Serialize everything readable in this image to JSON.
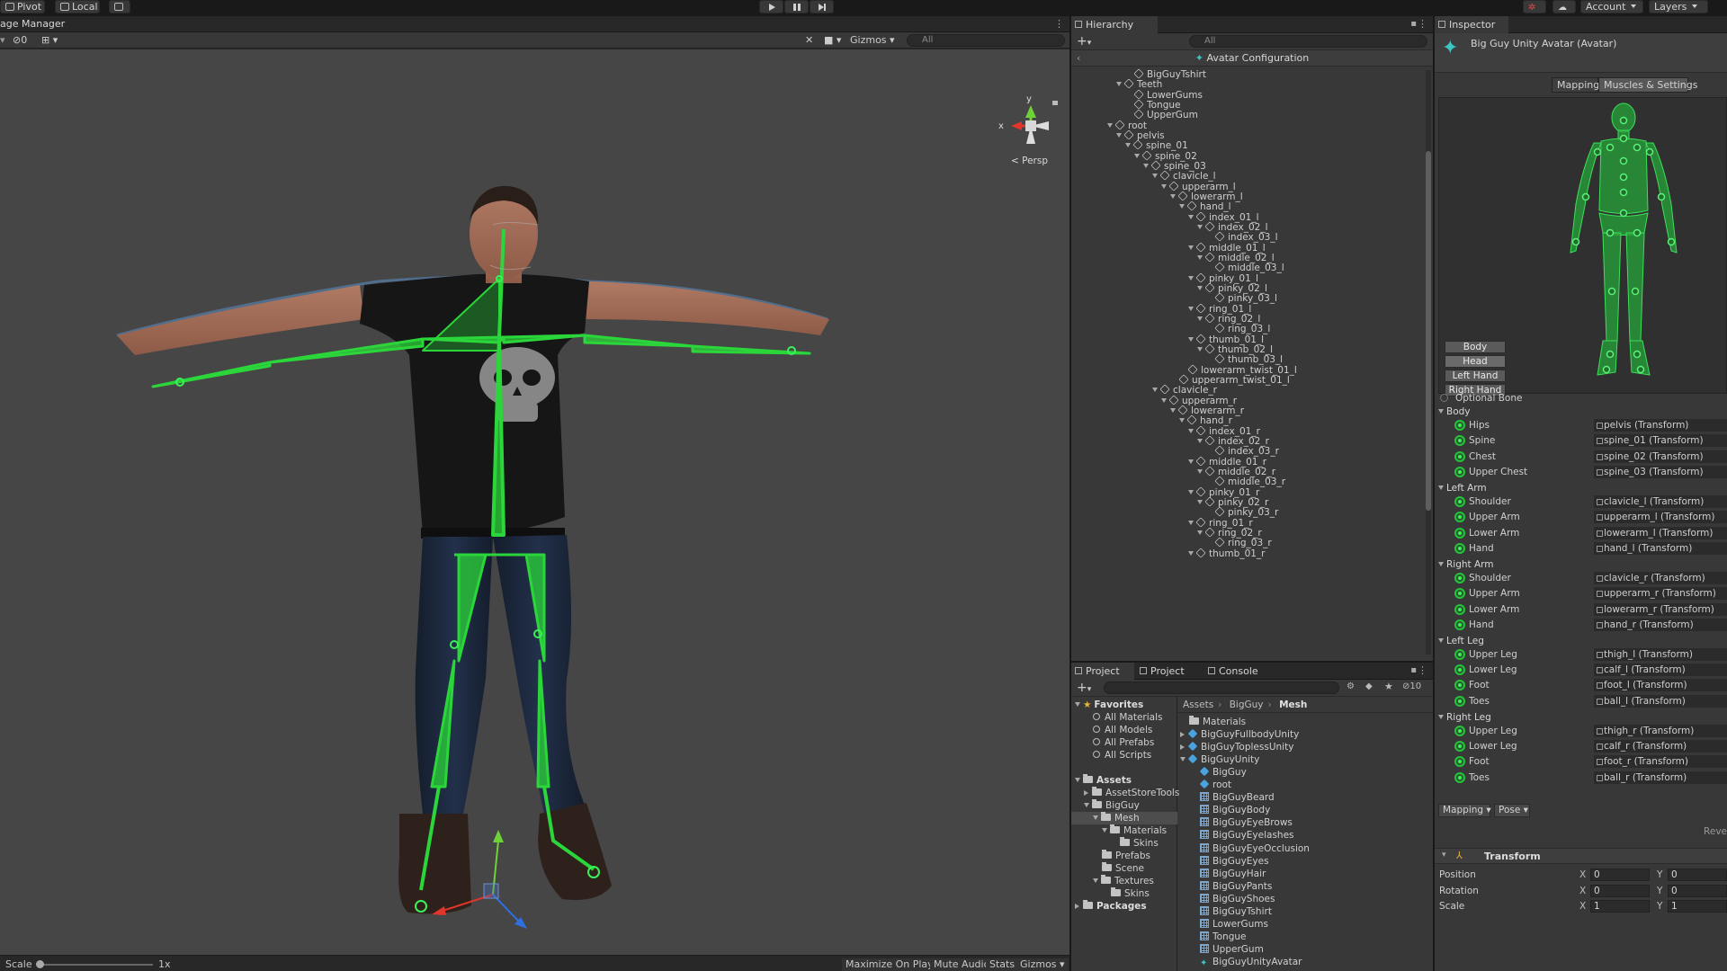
{
  "toolbar": {
    "pivot_label": "Pivot",
    "local_label": "Local",
    "account_label": "Account",
    "layers_label": "Layers"
  },
  "scene": {
    "tab_label": "age Manager",
    "hidden_count": "0",
    "gizmos_label": "Gizmos",
    "search_placeholder": "All",
    "persp_label": "< Persp",
    "axis_x": "x",
    "axis_y": "y",
    "bottom": {
      "scale_label": "Scale",
      "scale_value": "1x",
      "maximize_label": "Maximize On Play",
      "mute_label": "Mute Audio",
      "stats_label": "Stats",
      "gizmos_label": "Gizmos"
    }
  },
  "hierarchy": {
    "tab_label": "Hierarchy",
    "search_placeholder": "All",
    "breadcrumb": "Avatar Configuration",
    "rows": [
      {
        "label": "BigGuyTshirt",
        "depth": 3,
        "fold": false
      },
      {
        "label": "Teeth",
        "depth": 2,
        "fold": true
      },
      {
        "label": "LowerGums",
        "depth": 3,
        "fold": false
      },
      {
        "label": "Tongue",
        "depth": 3,
        "fold": false
      },
      {
        "label": "UpperGum",
        "depth": 3,
        "fold": false
      },
      {
        "label": "root",
        "depth": 1,
        "fold": true
      },
      {
        "label": "pelvis",
        "depth": 2,
        "fold": true
      },
      {
        "label": "spine_01",
        "depth": 3,
        "fold": true
      },
      {
        "label": "spine_02",
        "depth": 4,
        "fold": true
      },
      {
        "label": "spine_03",
        "depth": 5,
        "fold": true
      },
      {
        "label": "clavicle_l",
        "depth": 6,
        "fold": true
      },
      {
        "label": "upperarm_l",
        "depth": 7,
        "fold": true
      },
      {
        "label": "lowerarm_l",
        "depth": 8,
        "fold": true
      },
      {
        "label": "hand_l",
        "depth": 9,
        "fold": true
      },
      {
        "label": "index_01_l",
        "depth": 10,
        "fold": true
      },
      {
        "label": "index_02_l",
        "depth": 11,
        "fold": true
      },
      {
        "label": "index_03_l",
        "depth": 12,
        "fold": false
      },
      {
        "label": "middle_01_l",
        "depth": 10,
        "fold": true
      },
      {
        "label": "middle_02_l",
        "depth": 11,
        "fold": true
      },
      {
        "label": "middle_03_l",
        "depth": 12,
        "fold": false
      },
      {
        "label": "pinky_01_l",
        "depth": 10,
        "fold": true
      },
      {
        "label": "pinky_02_l",
        "depth": 11,
        "fold": true
      },
      {
        "label": "pinky_03_l",
        "depth": 12,
        "fold": false
      },
      {
        "label": "ring_01_l",
        "depth": 10,
        "fold": true
      },
      {
        "label": "ring_02_l",
        "depth": 11,
        "fold": true
      },
      {
        "label": "ring_03_l",
        "depth": 12,
        "fold": false
      },
      {
        "label": "thumb_01_l",
        "depth": 10,
        "fold": true
      },
      {
        "label": "thumb_02_l",
        "depth": 11,
        "fold": true
      },
      {
        "label": "thumb_03_l",
        "depth": 12,
        "fold": false
      },
      {
        "label": "lowerarm_twist_01_l",
        "depth": 9,
        "fold": false
      },
      {
        "label": "upperarm_twist_01_l",
        "depth": 8,
        "fold": false
      },
      {
        "label": "clavicle_r",
        "depth": 6,
        "fold": true
      },
      {
        "label": "upperarm_r",
        "depth": 7,
        "fold": true
      },
      {
        "label": "lowerarm_r",
        "depth": 8,
        "fold": true
      },
      {
        "label": "hand_r",
        "depth": 9,
        "fold": true
      },
      {
        "label": "index_01_r",
        "depth": 10,
        "fold": true
      },
      {
        "label": "index_02_r",
        "depth": 11,
        "fold": true
      },
      {
        "label": "index_03_r",
        "depth": 12,
        "fold": false
      },
      {
        "label": "middle_01_r",
        "depth": 10,
        "fold": true
      },
      {
        "label": "middle_02_r",
        "depth": 11,
        "fold": true
      },
      {
        "label": "middle_03_r",
        "depth": 12,
        "fold": false
      },
      {
        "label": "pinky_01_r",
        "depth": 10,
        "fold": true
      },
      {
        "label": "pinky_02_r",
        "depth": 11,
        "fold": true
      },
      {
        "label": "pinky_03_r",
        "depth": 12,
        "fold": false
      },
      {
        "label": "ring_01_r",
        "depth": 10,
        "fold": true
      },
      {
        "label": "ring_02_r",
        "depth": 11,
        "fold": true
      },
      {
        "label": "ring_03_r",
        "depth": 12,
        "fold": false
      },
      {
        "label": "thumb_01_r",
        "depth": 10,
        "fold": true
      }
    ]
  },
  "project": {
    "tabs": [
      "Project",
      "Project",
      "Console"
    ],
    "hidden_count": "10",
    "breadcrumb": [
      "Assets",
      "BigGuy",
      "Mesh"
    ],
    "left_tree": [
      {
        "label": "Favorites",
        "indent": 0,
        "icon": "star",
        "bold": true,
        "fold": "down"
      },
      {
        "label": "All Materials",
        "indent": 1,
        "icon": "mag"
      },
      {
        "label": "All Models",
        "indent": 1,
        "icon": "mag"
      },
      {
        "label": "All Prefabs",
        "indent": 1,
        "icon": "mag"
      },
      {
        "label": "All Scripts",
        "indent": 1,
        "icon": "mag"
      },
      {
        "label": "",
        "indent": 0,
        "icon": "none"
      },
      {
        "label": "Assets",
        "indent": 0,
        "icon": "folder",
        "bold": true,
        "fold": "down"
      },
      {
        "label": "AssetStoreTools",
        "indent": 1,
        "icon": "folder",
        "fold": "right"
      },
      {
        "label": "BigGuy",
        "indent": 1,
        "icon": "folder",
        "fold": "down"
      },
      {
        "label": "Mesh",
        "indent": 2,
        "icon": "folder",
        "fold": "down",
        "sel": true
      },
      {
        "label": "Materials",
        "indent": 3,
        "icon": "folder",
        "fold": "down"
      },
      {
        "label": "Skins",
        "indent": 4,
        "icon": "folder"
      },
      {
        "label": "Prefabs",
        "indent": 2,
        "icon": "folder"
      },
      {
        "label": "Scene",
        "indent": 2,
        "icon": "folder"
      },
      {
        "label": "Textures",
        "indent": 2,
        "icon": "folder",
        "fold": "down"
      },
      {
        "label": "Skins",
        "indent": 3,
        "icon": "folder"
      },
      {
        "label": "Packages",
        "indent": 0,
        "icon": "folder",
        "bold": true,
        "fold": "right"
      }
    ],
    "right_list": [
      {
        "label": "Materials",
        "indent": 0,
        "icon": "folder"
      },
      {
        "label": "BigGuyFullbodyUnity",
        "indent": 0,
        "icon": "prefab",
        "fold": "right"
      },
      {
        "label": "BigGuyToplessUnity",
        "indent": 0,
        "icon": "prefab",
        "fold": "right"
      },
      {
        "label": "BigGuyUnity",
        "indent": 0,
        "icon": "prefab",
        "fold": "down"
      },
      {
        "label": "BigGuy",
        "indent": 1,
        "icon": "prefab"
      },
      {
        "label": "root",
        "indent": 1,
        "icon": "prefab"
      },
      {
        "label": "BigGuyBeard",
        "indent": 1,
        "icon": "mesh"
      },
      {
        "label": "BigGuyBody",
        "indent": 1,
        "icon": "mesh"
      },
      {
        "label": "BigGuyEyeBrows",
        "indent": 1,
        "icon": "mesh"
      },
      {
        "label": "BigGuyEyelashes",
        "indent": 1,
        "icon": "mesh"
      },
      {
        "label": "BigGuyEyeOcclusion",
        "indent": 1,
        "icon": "mesh"
      },
      {
        "label": "BigGuyEyes",
        "indent": 1,
        "icon": "mesh"
      },
      {
        "label": "BigGuyHair",
        "indent": 1,
        "icon": "mesh"
      },
      {
        "label": "BigGuyPants",
        "indent": 1,
        "icon": "mesh"
      },
      {
        "label": "BigGuyShoes",
        "indent": 1,
        "icon": "mesh"
      },
      {
        "label": "BigGuyTshirt",
        "indent": 1,
        "icon": "mesh"
      },
      {
        "label": "LowerGums",
        "indent": 1,
        "icon": "mesh"
      },
      {
        "label": "Tongue",
        "indent": 1,
        "icon": "mesh"
      },
      {
        "label": "UpperGum",
        "indent": 1,
        "icon": "mesh"
      },
      {
        "label": "BigGuyUnityAvatar",
        "indent": 1,
        "icon": "avatar"
      }
    ]
  },
  "inspector": {
    "tab_label": "Inspector",
    "title": "Big Guy Unity Avatar (Avatar)",
    "seg_mapping": "Mapping",
    "seg_muscles": "Muscles & Settings",
    "part_buttons": [
      "Body",
      "Head",
      "Left Hand",
      "Right Hand"
    ],
    "optional_bone": "Optional Bone",
    "groups": [
      {
        "name": "Body",
        "bones": [
          {
            "name": "Hips",
            "value": "pelvis (Transform)"
          },
          {
            "name": "Spine",
            "value": "spine_01 (Transform)"
          },
          {
            "name": "Chest",
            "value": "spine_02 (Transform)"
          },
          {
            "name": "Upper Chest",
            "value": "spine_03 (Transform)"
          }
        ]
      },
      {
        "name": "Left Arm",
        "bones": [
          {
            "name": "Shoulder",
            "value": "clavicle_l (Transform)"
          },
          {
            "name": "Upper Arm",
            "value": "upperarm_l (Transform)"
          },
          {
            "name": "Lower Arm",
            "value": "lowerarm_l (Transform)"
          },
          {
            "name": "Hand",
            "value": "hand_l (Transform)"
          }
        ]
      },
      {
        "name": "Right Arm",
        "bones": [
          {
            "name": "Shoulder",
            "value": "clavicle_r (Transform)"
          },
          {
            "name": "Upper Arm",
            "value": "upperarm_r (Transform)"
          },
          {
            "name": "Lower Arm",
            "value": "lowerarm_r (Transform)"
          },
          {
            "name": "Hand",
            "value": "hand_r (Transform)"
          }
        ]
      },
      {
        "name": "Left Leg",
        "bones": [
          {
            "name": "Upper Leg",
            "value": "thigh_l (Transform)"
          },
          {
            "name": "Lower Leg",
            "value": "calf_l (Transform)"
          },
          {
            "name": "Foot",
            "value": "foot_l (Transform)"
          },
          {
            "name": "Toes",
            "value": "ball_l (Transform)"
          }
        ]
      },
      {
        "name": "Right Leg",
        "bones": [
          {
            "name": "Upper Leg",
            "value": "thigh_r (Transform)"
          },
          {
            "name": "Lower Leg",
            "value": "calf_r (Transform)"
          },
          {
            "name": "Foot",
            "value": "foot_r (Transform)"
          },
          {
            "name": "Toes",
            "value": "ball_r (Transform)"
          }
        ]
      }
    ],
    "mapping_dd": "Mapping",
    "pose_dd": "Pose",
    "revert_label": "Reve",
    "transform": {
      "title": "Transform",
      "rows": [
        {
          "label": "Position",
          "x": "0",
          "y": "0"
        },
        {
          "label": "Rotation",
          "x": "0",
          "y": "0"
        },
        {
          "label": "Scale",
          "x": "1",
          "y": "1"
        }
      ]
    }
  },
  "colors": {
    "skeleton_green": "#2bd63a",
    "axis_red": "#e0352b",
    "axis_green": "#6fd13a",
    "axis_blue": "#2f6fe0",
    "avatar_cyan": "#3bc7c2"
  }
}
